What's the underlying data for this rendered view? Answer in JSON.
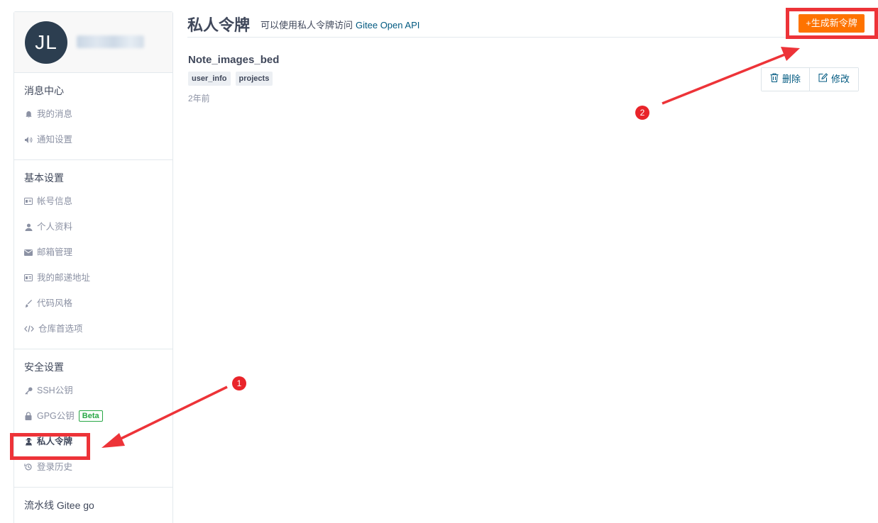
{
  "sidebar": {
    "avatar_initials": "JL",
    "sections": [
      {
        "title": "消息中心",
        "items": [
          {
            "label": "我的消息",
            "icon": "bell-icon"
          },
          {
            "label": "通知设置",
            "icon": "volume-icon"
          }
        ]
      },
      {
        "title": "基本设置",
        "items": [
          {
            "label": "帐号信息",
            "icon": "id-card-icon"
          },
          {
            "label": "个人资料",
            "icon": "user-icon"
          },
          {
            "label": "邮箱管理",
            "icon": "envelope-icon"
          },
          {
            "label": "我的邮递地址",
            "icon": "address-card-icon"
          },
          {
            "label": "代码风格",
            "icon": "brush-icon"
          },
          {
            "label": "仓库首选项",
            "icon": "code-icon"
          }
        ]
      },
      {
        "title": "安全设置",
        "items": [
          {
            "label": "SSH公钥",
            "icon": "key-icon"
          },
          {
            "label": "GPG公钥",
            "icon": "lock-icon",
            "badge": "Beta"
          },
          {
            "label": "私人令牌",
            "icon": "user-secret-icon",
            "active": true
          },
          {
            "label": "登录历史",
            "icon": "history-icon"
          }
        ]
      },
      {
        "title": "流水线 Gitee go",
        "items": []
      }
    ]
  },
  "header": {
    "title": "私人令牌",
    "subtitle": "可以使用私人令牌访问",
    "api_link": "Gitee Open API",
    "generate_button": "+生成新令牌"
  },
  "token": {
    "name": "Note_images_bed",
    "scopes": [
      "user_info",
      "projects"
    ],
    "time": "2年前",
    "delete_label": "删除",
    "edit_label": "修改"
  },
  "annotations": {
    "badge_1": "1",
    "badge_2": "2"
  },
  "colors": {
    "accent_orange": "#fe7300",
    "link": "#005980",
    "annotation_red": "#ed3338",
    "beta_green": "#28a745"
  }
}
